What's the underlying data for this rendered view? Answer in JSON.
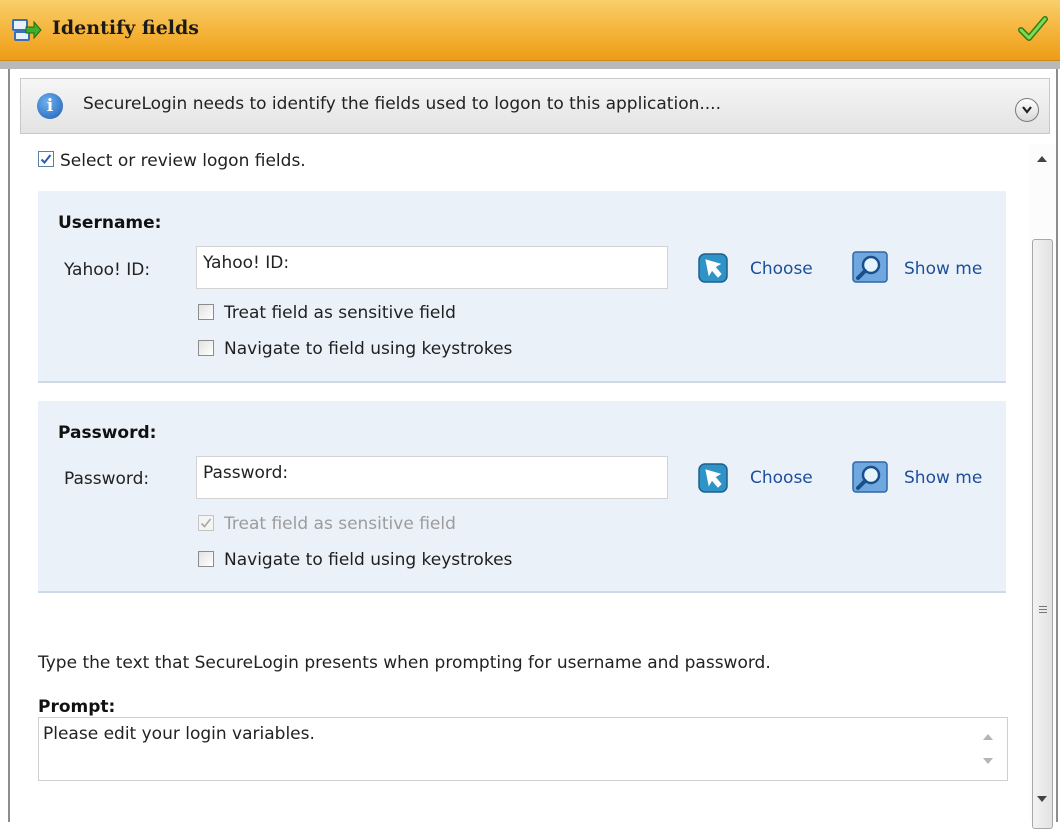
{
  "window": {
    "title": "Identify fields",
    "title_icon": "arrow-swap-icon",
    "status_icon": "green-check-icon",
    "accent": "#f5b53c"
  },
  "info_bar": {
    "icon": "info-icon",
    "text": "SecureLogin needs to identify the fields used to logon to this application....",
    "expand_icon": "chevron-down-icon"
  },
  "review": {
    "label": "Select or review logon fields.",
    "checked": true
  },
  "username": {
    "heading": "Username:",
    "field_label": "Yahoo! ID:",
    "field_value": "Yahoo! ID:",
    "sensitive_label": "Treat field as sensitive field",
    "sensitive_checked": false,
    "navigate_label": "Navigate to field using keystrokes",
    "navigate_checked": false,
    "choose_label": "Choose",
    "showme_label": "Show me"
  },
  "password": {
    "heading": "Password:",
    "field_label": "Password:",
    "field_value": "Password:",
    "sensitive_label": "Treat field as sensitive field",
    "sensitive_checked": true,
    "sensitive_disabled": true,
    "navigate_label": "Navigate to field using keystrokes",
    "navigate_checked": false,
    "choose_label": "Choose",
    "showme_label": "Show me"
  },
  "prompt": {
    "hint": "Type the text that SecureLogin presents when prompting for username and password.",
    "heading": "Prompt:",
    "value": "Please edit your login variables."
  }
}
